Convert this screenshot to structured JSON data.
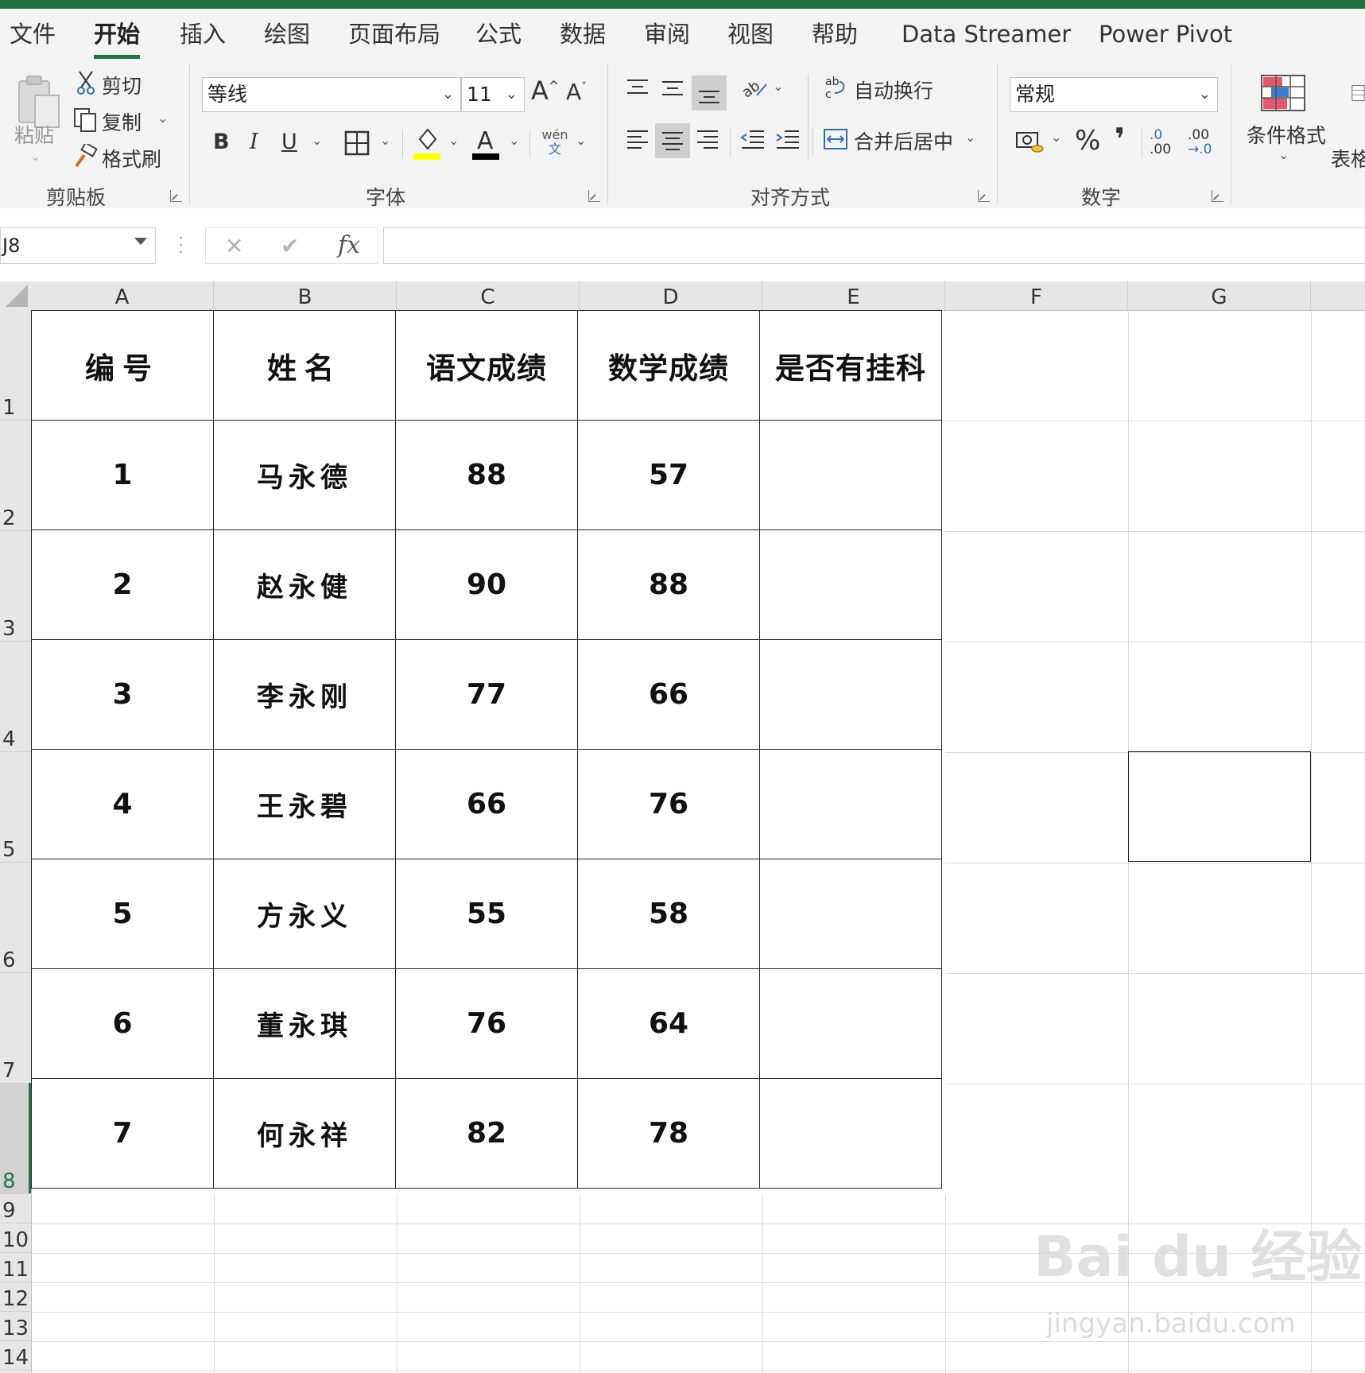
{
  "tabs": [
    {
      "label": "文件"
    },
    {
      "label": "开始"
    },
    {
      "label": "插入"
    },
    {
      "label": "绘图"
    },
    {
      "label": "页面布局"
    },
    {
      "label": "公式"
    },
    {
      "label": "数据"
    },
    {
      "label": "审阅"
    },
    {
      "label": "视图"
    },
    {
      "label": "帮助"
    },
    {
      "label": "Data Streamer"
    },
    {
      "label": "Power Pivot"
    }
  ],
  "active_tab": "开始",
  "ribbon": {
    "clipboard": {
      "paste": "粘贴",
      "cut": "剪切",
      "copy": "复制",
      "format_painter": "格式刷",
      "label": "剪贴板"
    },
    "font": {
      "font_name": "等线",
      "font_size": "11",
      "grow": "A",
      "shrink": "A",
      "bold": "B",
      "italic": "I",
      "underline": "U",
      "phonetic_top": "wén",
      "phonetic_bottom": "文",
      "font_color_letter": "A",
      "label": "字体"
    },
    "alignment": {
      "wrap_text": "自动换行",
      "merge_center": "合并后居中",
      "label": "对齐方式"
    },
    "number": {
      "format": "常规",
      "percent": "%",
      "comma": "❜",
      "inc_decimal_top": ".0",
      "inc_decimal_bottom": ".00",
      "dec_decimal_top": ".00",
      "dec_decimal_bottom": "→.0",
      "label": "数字"
    },
    "styles": {
      "conditional_formatting": "条件格式",
      "table_format": "表格"
    }
  },
  "formula_bar": {
    "name_box": "J8",
    "cancel": "✕",
    "enter": "✔",
    "fx": "fx",
    "content": ""
  },
  "grid": {
    "columns": [
      "A",
      "B",
      "C",
      "D",
      "E",
      "F",
      "G"
    ],
    "rows": [
      "1",
      "2",
      "3",
      "4",
      "5",
      "6",
      "7",
      "8",
      "9",
      "10",
      "11",
      "12",
      "13",
      "14"
    ],
    "selected_row": "8"
  },
  "table": {
    "headers": [
      "编号",
      "姓名",
      "语文成绩",
      "数学成绩",
      "是否有挂科"
    ],
    "rows": [
      [
        "1",
        "马永德",
        "88",
        "57",
        ""
      ],
      [
        "2",
        "赵永健",
        "90",
        "88",
        ""
      ],
      [
        "3",
        "李永刚",
        "77",
        "66",
        ""
      ],
      [
        "4",
        "王永碧",
        "66",
        "76",
        ""
      ],
      [
        "5",
        "方永义",
        "55",
        "58",
        ""
      ],
      [
        "6",
        "董永琪",
        "76",
        "64",
        ""
      ],
      [
        "7",
        "何永祥",
        "82",
        "78",
        ""
      ]
    ]
  },
  "watermark": {
    "main": "Bai du 经验",
    "sub": "jingyan.baidu.com"
  },
  "colors": {
    "excel_green": "#217346",
    "highlight_yellow": "#ffff00",
    "font_color_red": "#000000"
  }
}
